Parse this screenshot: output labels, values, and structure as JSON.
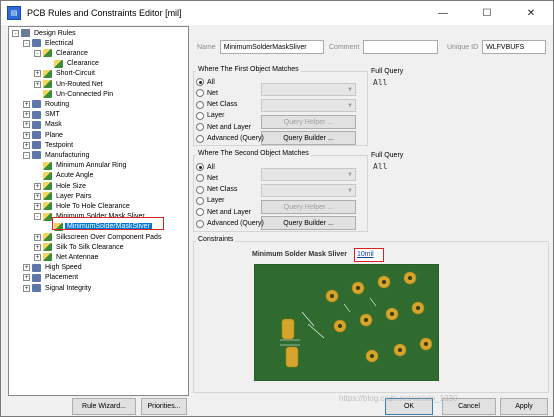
{
  "window": {
    "title": "PCB Rules and Constraints Editor [mil]",
    "minimize": "—",
    "maximize": "☐",
    "close": "✕"
  },
  "tree": {
    "items": [
      {
        "label": "Design Rules",
        "depth": 0,
        "expander": "-",
        "icon": "book"
      },
      {
        "label": "Electrical",
        "depth": 1,
        "expander": "-",
        "icon": "cat"
      },
      {
        "label": "Clearance",
        "depth": 2,
        "expander": "-",
        "icon": "rule"
      },
      {
        "label": "Clearance",
        "depth": 3,
        "expander": "",
        "icon": "rule"
      },
      {
        "label": "Short-Circuit",
        "depth": 2,
        "expander": "+",
        "icon": "rule"
      },
      {
        "label": "Un-Routed Net",
        "depth": 2,
        "expander": "+",
        "icon": "rule"
      },
      {
        "label": "Un-Connected Pin",
        "depth": 2,
        "expander": "",
        "icon": "rule"
      },
      {
        "label": "Routing",
        "depth": 1,
        "expander": "+",
        "icon": "cat"
      },
      {
        "label": "SMT",
        "depth": 1,
        "expander": "+",
        "icon": "cat"
      },
      {
        "label": "Mask",
        "depth": 1,
        "expander": "+",
        "icon": "cat"
      },
      {
        "label": "Plane",
        "depth": 1,
        "expander": "+",
        "icon": "cat"
      },
      {
        "label": "Testpoint",
        "depth": 1,
        "expander": "+",
        "icon": "cat"
      },
      {
        "label": "Manufacturing",
        "depth": 1,
        "expander": "-",
        "icon": "cat"
      },
      {
        "label": "Minimum Annular Ring",
        "depth": 2,
        "expander": "",
        "icon": "rule"
      },
      {
        "label": "Acute Angle",
        "depth": 2,
        "expander": "",
        "icon": "rule"
      },
      {
        "label": "Hole Size",
        "depth": 2,
        "expander": "+",
        "icon": "rule"
      },
      {
        "label": "Layer Pairs",
        "depth": 2,
        "expander": "+",
        "icon": "rule"
      },
      {
        "label": "Hole To Hole Clearance",
        "depth": 2,
        "expander": "+",
        "icon": "rule"
      },
      {
        "label": "Minimum Solder Mask Sliver",
        "depth": 2,
        "expander": "-",
        "icon": "rule"
      },
      {
        "label": "MinimumSolderMaskSliver",
        "depth": 3,
        "expander": "",
        "icon": "rule",
        "selected": true
      },
      {
        "label": "Silkscreen Over Component Pads",
        "depth": 2,
        "expander": "+",
        "icon": "rule"
      },
      {
        "label": "Silk To Silk Clearance",
        "depth": 2,
        "expander": "+",
        "icon": "rule"
      },
      {
        "label": "Net Antennae",
        "depth": 2,
        "expander": "+",
        "icon": "rule"
      },
      {
        "label": "High Speed",
        "depth": 1,
        "expander": "+",
        "icon": "cat"
      },
      {
        "label": "Placement",
        "depth": 1,
        "expander": "+",
        "icon": "cat"
      },
      {
        "label": "Signal Integrity",
        "depth": 1,
        "expander": "+",
        "icon": "cat"
      }
    ]
  },
  "header": {
    "name_label": "Name",
    "name_value": "MinimumSolderMaskSliver",
    "comment_label": "Comment",
    "comment_value": "",
    "uid_label": "Unique ID",
    "uid_value": "WLFVBUFS"
  },
  "first_match": {
    "title": "Where The First Object Matches",
    "options": [
      "All",
      "Net",
      "Net Class",
      "Layer",
      "Net and Layer",
      "Advanced (Query)"
    ],
    "selected": "All",
    "query_helper": "Query Helper ...",
    "query_builder": "Query Builder ...",
    "full_query_label": "Full Query",
    "full_query_value": "All"
  },
  "second_match": {
    "title": "Where The Second Object Matches",
    "options": [
      "All",
      "Net",
      "Net Class",
      "Layer",
      "Net and Layer",
      "Advanced (Query)"
    ],
    "selected": "All",
    "query_helper": "Query Helper ...",
    "query_builder": "Query Builder ...",
    "full_query_label": "Full Query",
    "full_query_value": "All"
  },
  "constraints": {
    "title": "Constraints",
    "label": "Minimum Solder Mask Sliver",
    "value": "10mil"
  },
  "footer": {
    "rule_wizard": "Rule Wizard...",
    "priorities": "Priorities...",
    "ok": "OK",
    "cancel": "Cancel",
    "apply": "Apply"
  },
  "watermark": "https://blog.csdn.net/weixin_1030",
  "colors": {
    "pcb_green": "#2f6b2f",
    "pad_gold": "#d4a52a",
    "highlight_red": "#e02020",
    "selection_blue": "#0078d7"
  }
}
